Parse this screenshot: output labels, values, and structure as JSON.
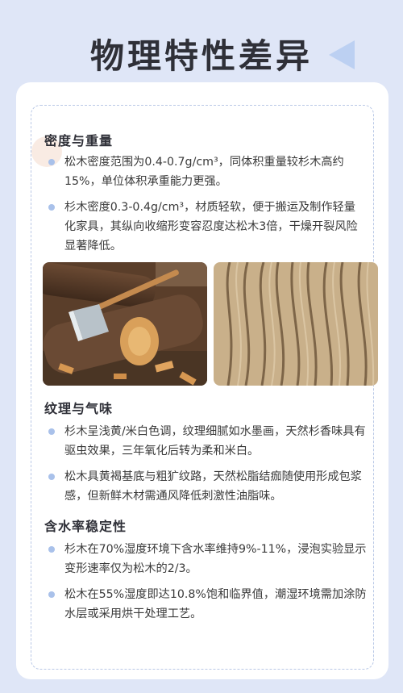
{
  "page": {
    "title": "物理特性差异"
  },
  "sections": [
    {
      "heading": "密度与重量",
      "bullets": [
        "松木密度范围为0.4-0.7g/cm³，同体积重量较杉木高约15%，单位体积承重能力更强。",
        "杉木密度0.3-0.4g/cm³，材质轻软，便于搬运及制作轻量化家具，其纵向收缩形变容忍度达松木3倍，干燥开裂风险显著降低。"
      ]
    },
    {
      "heading": "纹理与气味",
      "bullets": [
        "杉木呈浅黄/米白色调，纹理细腻如水墨画，天然杉香味具有驱虫效果，三年氧化后转为柔和米白。",
        "松木具黄褐基底与粗犷纹路，天然松脂结痂随使用形成包浆感，但新鲜木材需通风降低刺激性油脂味。"
      ]
    },
    {
      "heading": "含水率稳定性",
      "bullets": [
        "杉木在70%湿度环境下含水率维持9%-11%，浸泡实验显示变形速率仅为松木的2/3。",
        "松木在55%湿度即达10.8%饱和临界值，潮湿环境需加涂防水层或采用烘干处理工艺。"
      ]
    }
  ],
  "images": [
    {
      "icon": "split-log-with-axe-photo"
    },
    {
      "icon": "wood-grain-texture-photo"
    }
  ]
}
